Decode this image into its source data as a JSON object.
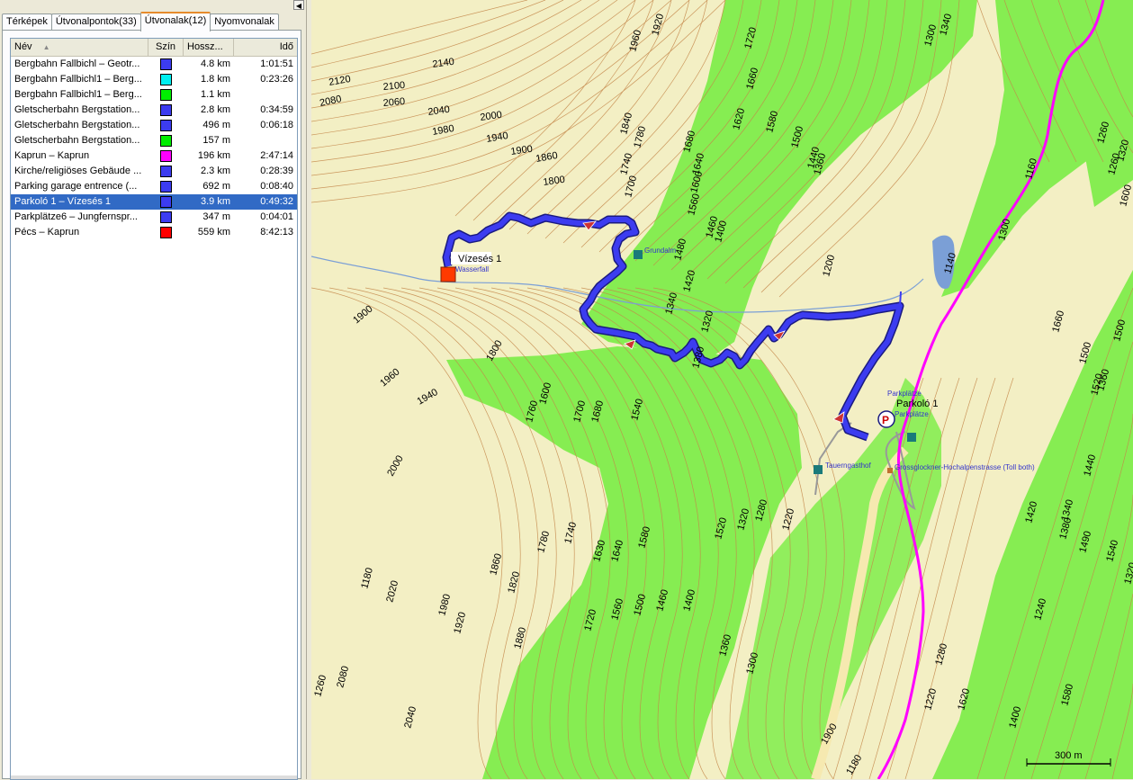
{
  "tabs": [
    "Térképek",
    "Útvonalpontok(33)",
    "Útvonalak(12)",
    "Nyomvonalak"
  ],
  "columns": {
    "name": "Név",
    "color": "Szín",
    "length": "Hossz...",
    "time": "Idő"
  },
  "routes": [
    {
      "name": "Bergbahn Fallbichl – Geotr...",
      "color": "#3c3cf0",
      "length": "4.8 km",
      "time": "1:01:51"
    },
    {
      "name": "Bergbahn Fallbichl1 – Berg...",
      "color": "#00f0f0",
      "length": "1.8 km",
      "time": "0:23:26"
    },
    {
      "name": "Bergbahn Fallbichl1 – Berg...",
      "color": "#00ee00",
      "length": "1.1 km",
      "time": ""
    },
    {
      "name": "Gletscherbahn Bergstation...",
      "color": "#3c3cf0",
      "length": "2.8 km",
      "time": "0:34:59"
    },
    {
      "name": "Gletscherbahn Bergstation...",
      "color": "#3c3cf0",
      "length": "496 m",
      "time": "0:06:18"
    },
    {
      "name": "Gletscherbahn Bergstation...",
      "color": "#00ee00",
      "length": "157 m",
      "time": ""
    },
    {
      "name": "Kaprun – Kaprun",
      "color": "#ff00ff",
      "length": "196 km",
      "time": "2:47:14"
    },
    {
      "name": "Kirche/religiöses Gebäude ...",
      "color": "#3c3cf0",
      "length": "2.3 km",
      "time": "0:28:39"
    },
    {
      "name": "Parking garage entrence (...",
      "color": "#3c3cf0",
      "length": "692 m",
      "time": "0:08:40"
    },
    {
      "name": "Parkoló 1 – Vízesés 1",
      "color": "#3c3cf0",
      "length": "3.9 km",
      "time": "0:49:32",
      "selected": true
    },
    {
      "name": "Parkplätze6 – Jungfernspr...",
      "color": "#3c3cf0",
      "length": "347 m",
      "time": "0:04:01"
    },
    {
      "name": "Pécs – Kaprun",
      "color": "#ff0000",
      "length": "559 km",
      "time": "8:42:13"
    }
  ],
  "map": {
    "waypoint_start": "Parkoló 1",
    "waypoint_end": "Vízesés 1",
    "poi": {
      "grundalm": "Grundalm",
      "tauerngasthof": "Tauerngasthof",
      "parkplatze1": "Parkplätze",
      "parkplatze2": "Parkplätze",
      "wasserfall": "Wasserfall",
      "road": "Grossglockner-Hochalpenstrasse (Toll both)"
    },
    "scale": "300 m",
    "contour_labels": [
      {
        "t": "2140"
      },
      {
        "t": "2120"
      },
      {
        "t": "2100"
      },
      {
        "t": "2080"
      },
      {
        "t": "2060"
      },
      {
        "t": "2040"
      },
      {
        "t": "2000"
      },
      {
        "t": "1980"
      },
      {
        "t": "1940"
      },
      {
        "t": "1900"
      },
      {
        "t": "1860"
      },
      {
        "t": "1800"
      },
      {
        "t": "1960"
      },
      {
        "t": "1920"
      },
      {
        "t": "1720"
      },
      {
        "t": "1660"
      },
      {
        "t": "1620"
      },
      {
        "t": "1580"
      },
      {
        "t": "1500"
      },
      {
        "t": "1440"
      },
      {
        "t": "1360"
      },
      {
        "t": "1840"
      },
      {
        "t": "1780"
      },
      {
        "t": "1740"
      },
      {
        "t": "1700"
      },
      {
        "t": "1680"
      },
      {
        "t": "1640"
      },
      {
        "t": "1600"
      },
      {
        "t": "1560"
      },
      {
        "t": "1460"
      },
      {
        "t": "1400"
      },
      {
        "t": "1480"
      },
      {
        "t": "1420"
      },
      {
        "t": "1200"
      },
      {
        "t": "1140"
      },
      {
        "t": "1340"
      },
      {
        "t": "1300"
      },
      {
        "t": "1260"
      },
      {
        "t": "1320"
      },
      {
        "t": "1160"
      },
      {
        "t": "1300"
      },
      {
        "t": "1900"
      },
      {
        "t": "1960"
      },
      {
        "t": "1940"
      },
      {
        "t": "1800"
      },
      {
        "t": "1600"
      },
      {
        "t": "1760"
      },
      {
        "t": "1700"
      },
      {
        "t": "1680"
      },
      {
        "t": "1540"
      },
      {
        "t": "1340"
      },
      {
        "t": "1320"
      },
      {
        "t": "1380"
      },
      {
        "t": "2000"
      },
      {
        "t": "1860"
      },
      {
        "t": "1820"
      },
      {
        "t": "1780"
      },
      {
        "t": "1740"
      },
      {
        "t": "1630"
      },
      {
        "t": "1640"
      },
      {
        "t": "1580"
      },
      {
        "t": "1520"
      },
      {
        "t": "1320"
      },
      {
        "t": "1280"
      },
      {
        "t": "1220"
      },
      {
        "t": "1180"
      },
      {
        "t": "2020"
      },
      {
        "t": "1980"
      },
      {
        "t": "1920"
      },
      {
        "t": "1880"
      },
      {
        "t": "1720"
      },
      {
        "t": "1560"
      },
      {
        "t": "1500"
      },
      {
        "t": "1460"
      },
      {
        "t": "1400"
      },
      {
        "t": "1360"
      },
      {
        "t": "1300"
      },
      {
        "t": "1260"
      },
      {
        "t": "2080"
      },
      {
        "t": "2040"
      },
      {
        "t": "1900"
      },
      {
        "t": "1180"
      },
      {
        "t": "1220"
      },
      {
        "t": "1280"
      },
      {
        "t": "1240"
      },
      {
        "t": "1420"
      },
      {
        "t": "1340"
      },
      {
        "t": "1380"
      },
      {
        "t": "1490"
      },
      {
        "t": "1540"
      },
      {
        "t": "1580"
      },
      {
        "t": "1620"
      },
      {
        "t": "1400"
      },
      {
        "t": "1500"
      },
      {
        "t": "1360"
      },
      {
        "t": "1500"
      },
      {
        "t": "1440"
      },
      {
        "t": "1520"
      },
      {
        "t": "1600"
      },
      {
        "t": "1260"
      },
      {
        "t": "1320"
      },
      {
        "t": "1660"
      },
      {
        "t": "1340"
      }
    ]
  }
}
